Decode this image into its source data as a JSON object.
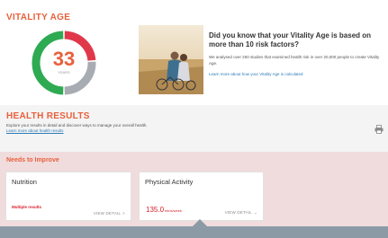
{
  "vitality_age": {
    "title": "VITALITY AGE",
    "age": "33",
    "age_sublabel": "YEARS",
    "headline": "Did you know that your Vitality Age is based on more than 10 risk factors?",
    "body": "We analysed over 250 studies that examined health risk in over 20,000 people to create Vitality Age.",
    "link": "Learn more about how your Vitality Age is calculated",
    "colors": {
      "red": "#e0384a",
      "green": "#2eaa52",
      "grey": "#a7abb2",
      "accent": "#e8603c"
    },
    "gauge_levels": {
      "red": 0.24,
      "grey": 0.26,
      "green": 0.5
    }
  },
  "health_results": {
    "title": "HEALTH RESULTS",
    "description": "Explore your results in detail and discover ways to manage your overall health.",
    "link": "Learn more about health results",
    "print_icon": "printer-icon"
  },
  "needs_to_improve": {
    "title": "Needs to Improve",
    "cards": [
      {
        "name": "Nutrition",
        "status": "Multiple results",
        "detail": "VIEW DETAIL",
        "chevron": ">"
      },
      {
        "name": "Physical Activity",
        "value": "135.0",
        "unit": "mins/week",
        "detail": "VIEW DETAIL",
        "chevron": "⌄"
      }
    ]
  }
}
